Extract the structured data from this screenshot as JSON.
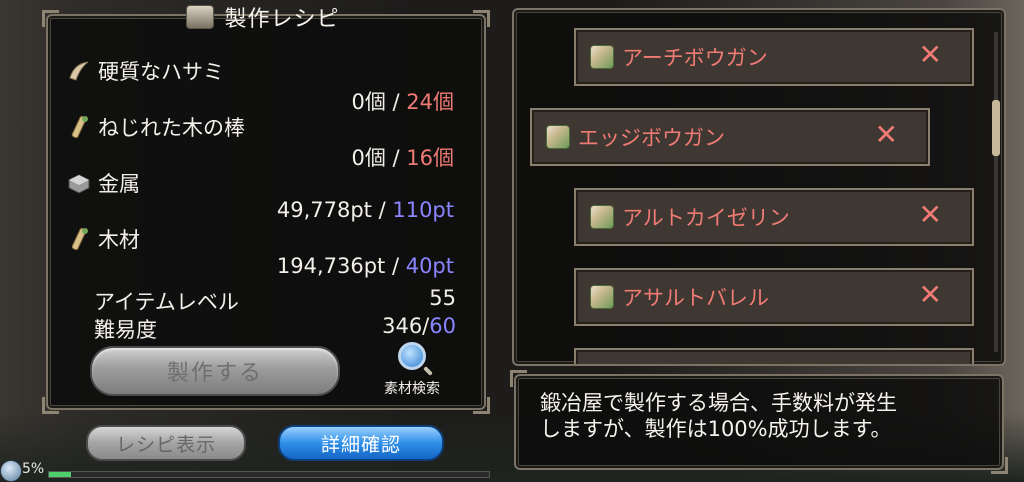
{
  "recipe_panel": {
    "title": "製作レシピ",
    "materials": [
      {
        "name": "硬質なハサミ",
        "have": "0個",
        "sep": " / ",
        "need": "24個",
        "need_color": "red",
        "icon": "claw-icon"
      },
      {
        "name": "ねじれた木の棒",
        "have": "0個",
        "sep": " / ",
        "need": "16個",
        "need_color": "red",
        "icon": "wood-stick-icon"
      },
      {
        "name": "金属",
        "have": "49,778pt",
        "sep": " / ",
        "need": "110pt",
        "need_color": "blue",
        "icon": "metal-ingot-icon"
      },
      {
        "name": "木材",
        "have": "194,736pt",
        "sep": " / ",
        "need": "40pt",
        "need_color": "blue",
        "icon": "lumber-icon"
      }
    ],
    "item_level_label": "アイテムレベル",
    "item_level_value": "55",
    "difficulty_label": "難易度",
    "difficulty_current": "346/",
    "difficulty_max": "60",
    "craft_button_label": "製作する",
    "material_search_label": "素材検索"
  },
  "bottom_buttons": {
    "recipe_display": "レシピ表示",
    "detail_confirm": "詳細確認"
  },
  "recipe_list": {
    "items": [
      {
        "name": "アーチボウガン",
        "mark": "✕",
        "icon": "crossbow-icon"
      },
      {
        "name": "エッジボウガン",
        "mark": "✕",
        "icon": "crossbow-icon"
      },
      {
        "name": "アルトカイゼリン",
        "mark": "✕",
        "icon": "crossbow-icon"
      },
      {
        "name": "アサルトバレル",
        "mark": "✕",
        "icon": "crossbow-icon"
      }
    ]
  },
  "message": {
    "line1": "鍛冶屋で製作する場合、手数料が発生",
    "line2": "しますが、製作は100%成功します。"
  },
  "status": {
    "percent_label": "5%",
    "progress": 0.05
  },
  "colors": {
    "need_red": "#f07a74",
    "need_blue": "#8a86ff",
    "primary_button": "#2f8fe8"
  }
}
